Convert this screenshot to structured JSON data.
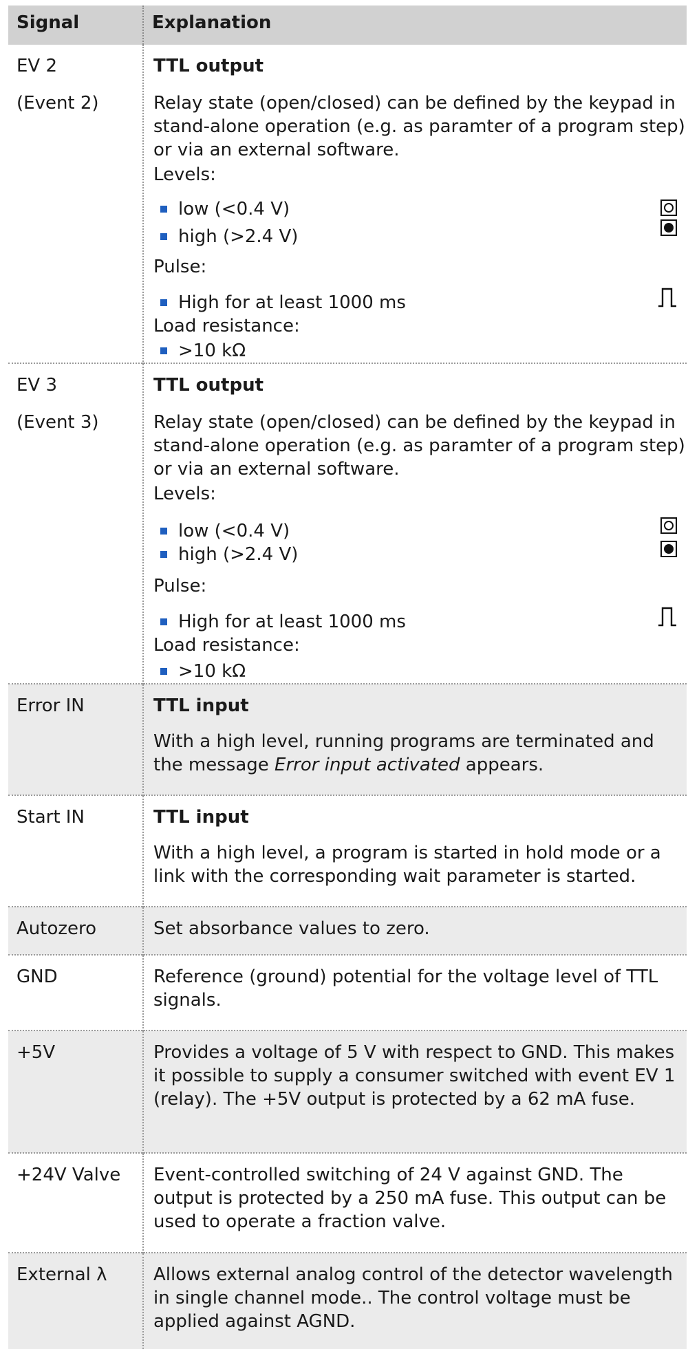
{
  "header": {
    "signal": "Signal",
    "explanation": "Explanation"
  },
  "ev2": {
    "signal": "EV 2",
    "signal_sub": "(Event 2)",
    "title": "TTL output",
    "desc": "Relay state (open/closed) can be defined by the keypad in stand-alone operation (e.g. as paramter of a program step) or via an external software.",
    "levels_label": "Levels:",
    "low": "low (<0.4 V)",
    "high": "high (>2.4 V)",
    "pulse_label": "Pulse:",
    "pulse": "High for at least 1000 ms",
    "load_label": "Load resistance:",
    "load": ">10 kΩ"
  },
  "ev3": {
    "signal": "EV 3",
    "signal_sub": "(Event 3)",
    "title": "TTL output",
    "desc": "Relay state (open/closed) can be defined by the keypad in stand-alone operation (e.g. as paramter of a program step) or via an external software.",
    "levels_label": "Levels:",
    "low": "low (<0.4 V)",
    "high": "high (>2.4 V)",
    "pulse_label": "Pulse:",
    "pulse": "High for at least 1000 ms",
    "load_label": "Load resistance:",
    "load": ">10 kΩ"
  },
  "error_in": {
    "signal": "Error IN",
    "title": "TTL input",
    "desc_before": "With a high level, running programs are terminated and the message ",
    "desc_italic": "Error input activated",
    "desc_after": " appears."
  },
  "start_in": {
    "signal": "Start IN",
    "title": "TTL input",
    "desc": "With a high level, a program is started in hold mode or a link with the corresponding wait parameter is started."
  },
  "autozero": {
    "signal": "Autozero",
    "desc": "Set absorbance values to zero."
  },
  "gnd": {
    "signal": "GND",
    "desc": "Reference (ground) potential for the voltage level of TTL signals."
  },
  "plus5v": {
    "signal": "+5V",
    "desc": "Provides a voltage of 5 V with respect to GND. This makes it possible to supply a consumer switched with event EV 1 (relay). The +5V output is protected by a 62 mA fuse."
  },
  "plus24v": {
    "signal": "+24V Valve",
    "desc": "Event-controlled switching of 24 V against GND. The output is protected by a 250 mA fuse. This output can be used to operate a fraction valve."
  },
  "ext_lambda": {
    "signal": "External λ",
    "desc": "Allows external analog control of the detector wavelength in single channel mode.. The control voltage must be applied against AGND."
  },
  "icons": {
    "low": "open-circle-box-icon",
    "high": "filled-circle-box-icon",
    "pulse": "pulse-waveform-icon",
    "bullet": "blue-square-bullet"
  },
  "colors": {
    "header_bg": "#d1d1d1",
    "grey_row_bg": "#ebebeb",
    "bullet": "#1f5fbf",
    "divider": "#9a9a9a"
  }
}
